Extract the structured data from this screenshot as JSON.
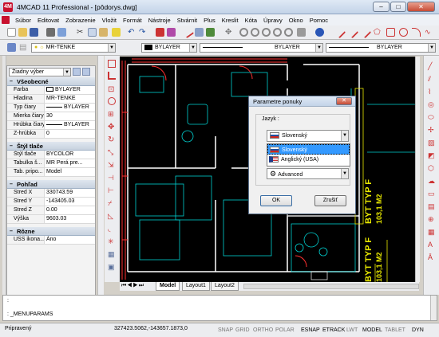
{
  "window": {
    "title": "4MCAD 11 Professional  - [pôdorys.dwg]",
    "icon": "4M"
  },
  "menu": [
    "Súbor",
    "Editovat",
    "Zobrazenie",
    "Vložit",
    "Formát",
    "Nástroje",
    "Stvárnit",
    "Plus",
    "Kreslit",
    "Kóta",
    "Úpravy",
    "Okno",
    "Pomoc"
  ],
  "properties_toolbar": {
    "layer": "MR-TENKE",
    "color": "BYLAYER",
    "linetype": "BYLAYER",
    "lineweight": "BYLAYER"
  },
  "panel": {
    "selection": "Žiadny výber",
    "sections": [
      {
        "title": "Všeobecné",
        "rows": [
          {
            "k": "Farba",
            "v": "BYLAYER"
          },
          {
            "k": "Hladina",
            "v": "MR-TENKE"
          },
          {
            "k": "Typ čiary",
            "v": "BYLAYER"
          },
          {
            "k": "Mierka čiary",
            "v": "30"
          },
          {
            "k": "Hrúbka čiary",
            "v": "BYLAYER"
          },
          {
            "k": "Z-hrúbka",
            "v": "0"
          }
        ]
      },
      {
        "title": "Štýl tlače",
        "rows": [
          {
            "k": "Štýl tlače",
            "v": "BYCOLOR"
          },
          {
            "k": "Tabulka š...",
            "v": "MR Perá pre..."
          },
          {
            "k": "Tab. pripo...",
            "v": "Model"
          }
        ]
      },
      {
        "title": "Pohľad",
        "rows": [
          {
            "k": "Stred X",
            "v": "330743.59"
          },
          {
            "k": "Stred Y",
            "v": "-143405.03"
          },
          {
            "k": "Stred Z",
            "v": "0.00"
          },
          {
            "k": "Výška",
            "v": "9603.03"
          }
        ]
      },
      {
        "title": "Rôzne",
        "rows": [
          {
            "k": "USS ikona...",
            "v": "Áno"
          }
        ]
      }
    ]
  },
  "drawing": {
    "texts": [
      {
        "t": "BYT TYP F",
        "rot": -90
      },
      {
        "t": "103,1 M2",
        "rot": -90
      },
      {
        "t": "BYT TYP F",
        "rot": -90
      },
      {
        "t": "103,1 M2",
        "rot": -90
      }
    ]
  },
  "dialog": {
    "title": "Parametre ponuky",
    "group_label": "Jazyk :",
    "selected": "Slovenský",
    "options": [
      "Slovenský",
      "Anglický (USA)"
    ],
    "second_combo": "Advanced",
    "ok": "OK",
    "cancel": "Zrušiť"
  },
  "layout_tabs": [
    "Model",
    "Layout1",
    "Layout2"
  ],
  "command": {
    "line1": ":",
    "line2": ": _MENUPARAMS"
  },
  "status": {
    "ready": "Pripravený",
    "coords": "327423.5062,-143657.1873,0",
    "toggles": [
      {
        "label": "SNAP",
        "on": false
      },
      {
        "label": "GRID",
        "on": false
      },
      {
        "label": "ORTHO",
        "on": false
      },
      {
        "label": "POLAR",
        "on": false
      },
      {
        "label": "ESNAP",
        "on": true
      },
      {
        "label": "ETRACK",
        "on": true
      },
      {
        "label": "LWT",
        "on": false
      },
      {
        "label": "MODEL",
        "on": true
      },
      {
        "label": "TABLET",
        "on": false
      },
      {
        "label": "DYN",
        "on": true
      }
    ]
  }
}
